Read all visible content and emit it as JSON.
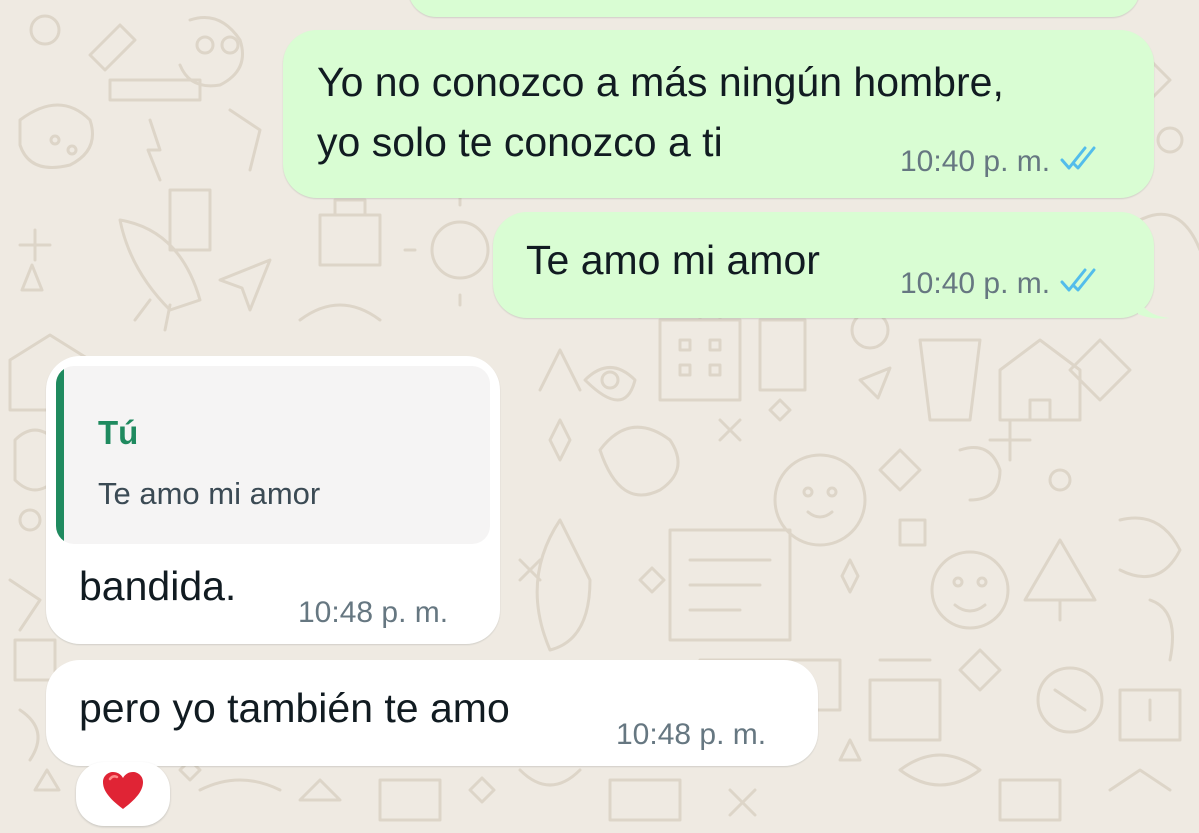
{
  "colors": {
    "wallpaper": "#efeae2",
    "doodle": "#ddd5c8",
    "outgoing_bubble": "#d9fdd3",
    "incoming_bubble": "#ffffff",
    "read_ticks": "#53bdeb",
    "quote_accent": "#1f8a5f"
  },
  "messages": [
    {
      "direction": "outgoing",
      "lines": [
        "Yo no conozco a más ningún hombre,",
        "yo solo te conozco a ti"
      ],
      "time": "10:40 p. m.",
      "status_icon": "double-check-read-icon"
    },
    {
      "direction": "outgoing",
      "lines": [
        "Te amo mi amor"
      ],
      "time": "10:40 p. m.",
      "status_icon": "double-check-read-icon"
    },
    {
      "direction": "incoming",
      "quote": {
        "author": "Tú",
        "text": "Te amo mi amor"
      },
      "lines": [
        "bandida."
      ],
      "time": "10:48 p. m."
    },
    {
      "direction": "incoming",
      "lines": [
        "pero yo también te amo"
      ],
      "time": "10:48 p. m.",
      "reaction": "❤️",
      "reaction_icon": "red-heart-icon"
    }
  ]
}
